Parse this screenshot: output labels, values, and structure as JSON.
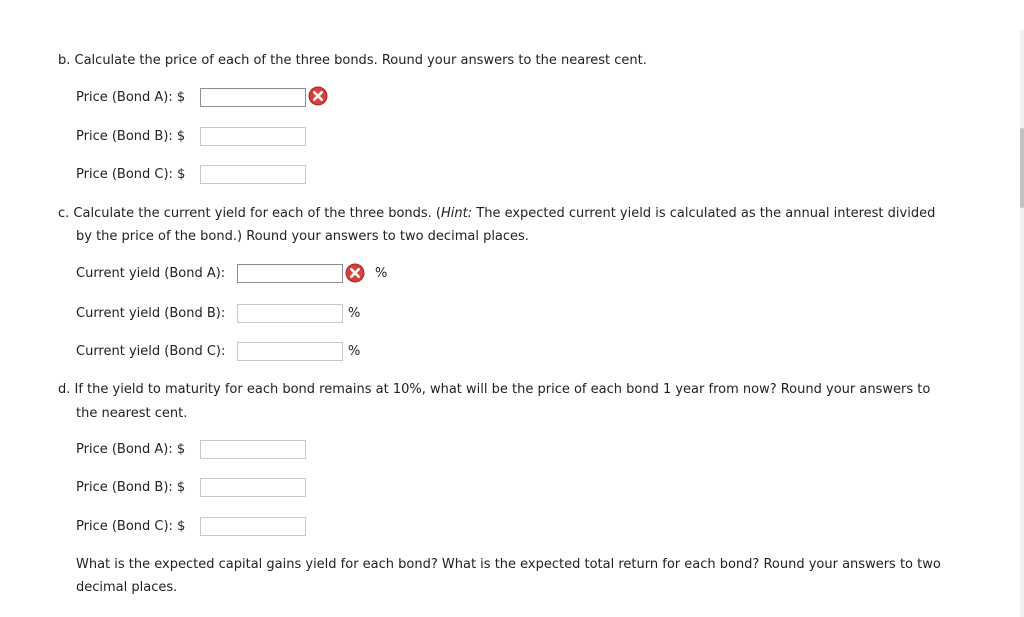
{
  "section_b": {
    "instruction": "b. Calculate the price of each of the three bonds. Round your answers to the nearest cent.",
    "rows": [
      {
        "label": "Price (Bond A): $",
        "value": "",
        "error": true
      },
      {
        "label": "Price (Bond B): $",
        "value": "",
        "error": false
      },
      {
        "label": "Price (Bond C): $",
        "value": "",
        "error": false
      }
    ]
  },
  "section_c": {
    "prefix": "c. Calculate the current yield for each of the three bonds. (",
    "hint_label": "Hint:",
    "hint_text": " The expected current yield is calculated as the annual interest divided",
    "line2": "by the price of the bond.) Round your answers to two decimal places.",
    "rows": [
      {
        "label": "Current yield (Bond A):",
        "value": "",
        "unit": "%",
        "error": true
      },
      {
        "label": "Current yield (Bond B):",
        "value": "",
        "unit": "%",
        "error": false
      },
      {
        "label": "Current yield (Bond C):",
        "value": "",
        "unit": "%",
        "error": false
      }
    ]
  },
  "section_d": {
    "line1": "d. If the yield to maturity for each bond remains at 10%, what will be the price of each bond 1 year from now? Round your answers to",
    "line2": "the nearest cent.",
    "rows": [
      {
        "label": "Price (Bond A): $",
        "value": "",
        "error": false
      },
      {
        "label": "Price (Bond B): $",
        "value": "",
        "error": false
      },
      {
        "label": "Price (Bond C): $",
        "value": "",
        "error": false
      }
    ],
    "followup_line1": "What is the expected capital gains yield for each bond? What is the expected total return for each bond? Round your answers to two",
    "followup_line2": "decimal places."
  },
  "colors": {
    "error_icon": "#c9302c",
    "text": "#222222",
    "input_border": "#c8c8c8"
  },
  "icons": {
    "error": "error-x-icon"
  }
}
